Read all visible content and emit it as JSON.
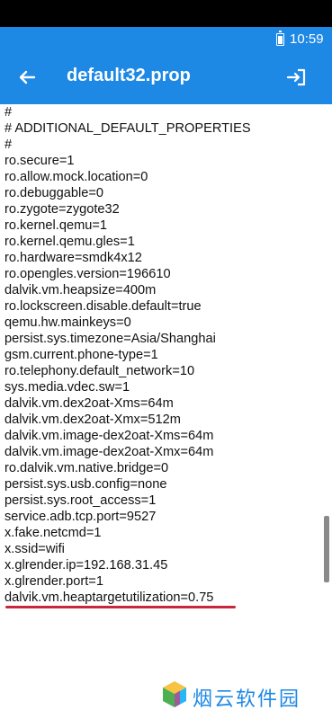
{
  "status_bar": {
    "time": "10:59",
    "battery_icon": "battery-full-icon"
  },
  "app_bar": {
    "title": "default32.prop",
    "back_icon": "arrow-left-icon",
    "exit_icon": "exit-icon"
  },
  "file_lines": [
    "#",
    "# ADDITIONAL_DEFAULT_PROPERTIES",
    "#",
    "ro.secure=1",
    "ro.allow.mock.location=0",
    "ro.debuggable=0",
    "ro.zygote=zygote32",
    "ro.kernel.qemu=1",
    "ro.kernel.qemu.gles=1",
    "ro.hardware=smdk4x12",
    "ro.opengles.version=196610",
    "dalvik.vm.heapsize=400m",
    "ro.lockscreen.disable.default=true",
    "qemu.hw.mainkeys=0",
    "persist.sys.timezone=Asia/Shanghai",
    "gsm.current.phone-type=1",
    "ro.telephony.default_network=10",
    "sys.media.vdec.sw=1",
    "dalvik.vm.dex2oat-Xms=64m",
    "dalvik.vm.dex2oat-Xmx=512m",
    "dalvik.vm.image-dex2oat-Xms=64m",
    "dalvik.vm.image-dex2oat-Xmx=64m",
    "ro.dalvik.vm.native.bridge=0",
    "persist.sys.usb.config=none",
    "persist.sys.root_access=1",
    "service.adb.tcp.port=9527",
    "x.fake.netcmd=1",
    "x.ssid=wifi",
    "x.glrender.ip=192.168.31.45",
    "x.glrender.port=1",
    "dalvik.vm.heaptargetutilization=0.75"
  ],
  "watermark": {
    "text": "烟云软件园",
    "logo_icon": "cube-logo-icon"
  },
  "colors": {
    "primary": "#1e88e5",
    "highlight": "#c8283c",
    "text": "#111111"
  }
}
